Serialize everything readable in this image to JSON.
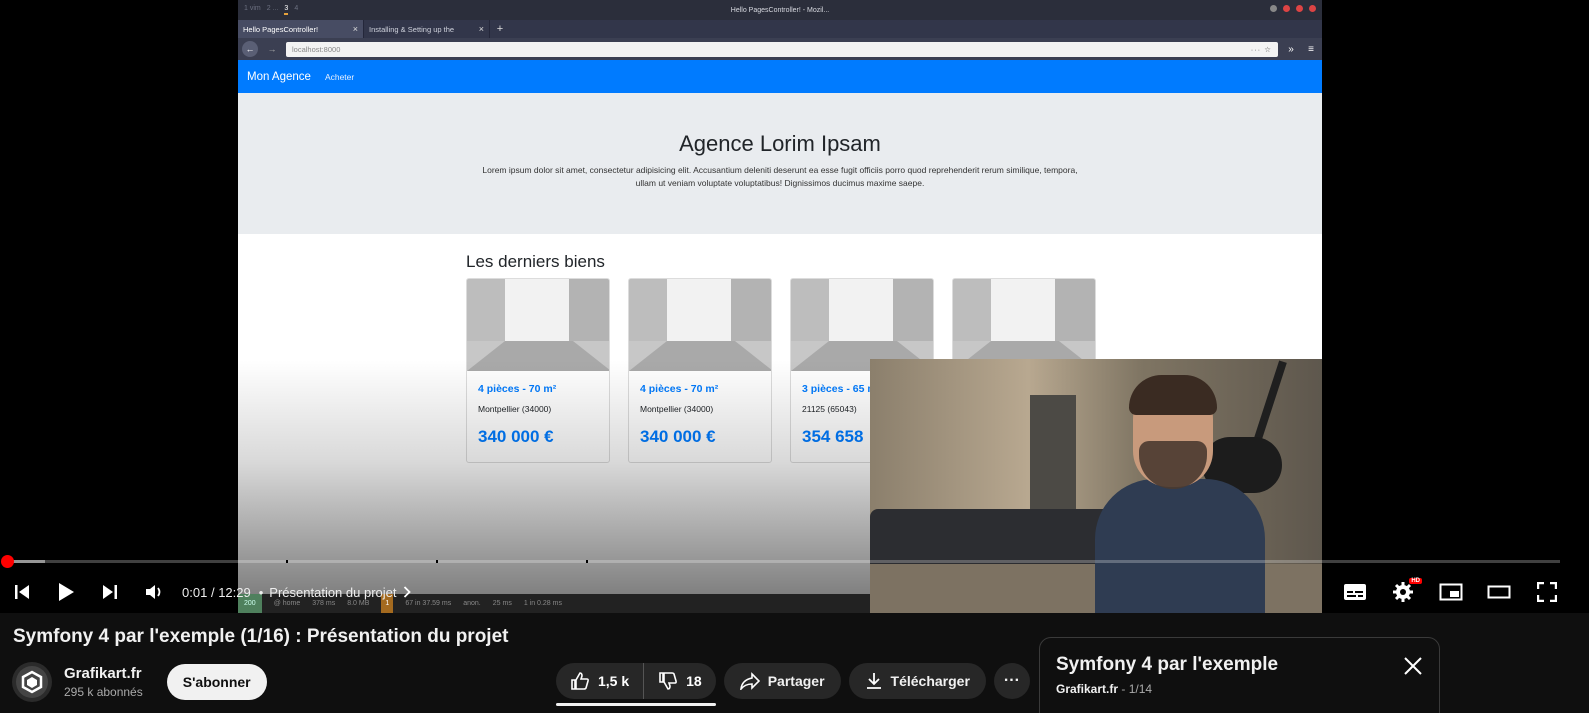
{
  "browser": {
    "workspaces": [
      "1 vim",
      "2 ...",
      "3",
      "4"
    ],
    "window_title": "Hello PagesController! - Mozil...",
    "tabs": [
      {
        "label": "Hello PagesController!",
        "active": true
      },
      {
        "label": "Installing & Setting up the",
        "active": false
      }
    ],
    "url": "localhost:8000"
  },
  "site": {
    "brand": "Mon Agence",
    "nav_link": "Acheter",
    "hero_title": "Agence Lorim Ipsam",
    "hero_text": "Lorem ipsum dolor sit amet, consectetur adipisicing elit. Accusantium deleniti deserunt ea esse fugit officiis porro quod reprehenderit rerum similique, tempora, ullam ut veniam voluptate voluptatibus! Dignissimos ducimus maxime saepe.",
    "section_title": "Les derniers biens",
    "cards": [
      {
        "title": "4 pièces - 70 m²",
        "location": "Montpellier (34000)",
        "price": "340 000 €"
      },
      {
        "title": "4 pièces - 70 m²",
        "location": "Montpellier (34000)",
        "price": "340 000 €"
      },
      {
        "title": "3 pièces - 65 m",
        "location": "21125 (65043)",
        "price": "354 658"
      },
      {
        "title": "",
        "location": "",
        "price": ""
      }
    ]
  },
  "debug_bar": {
    "status": "200",
    "route": "@ home",
    "time": "378 ms",
    "memory": "8.0 MB",
    "warnings": "1",
    "cache": "67 in 37.59 ms",
    "user": "anon.",
    "twig": "25 ms",
    "db": "1 in 0.28 ms"
  },
  "player": {
    "time_current": "0:01",
    "time_total": "12:29",
    "time_separator": "/",
    "chapter": "Présentation du projet",
    "progress_fraction": 0.0008,
    "buffer_fraction": 0.025,
    "hd_badge": "HD"
  },
  "video": {
    "title": "Symfony 4 par l'exemple (1/16) : Présentation du projet",
    "channel_name": "Grafikart.fr",
    "subscribers": "295 k abonnés",
    "subscribe_label": "S'abonner",
    "likes": "1,5 k",
    "dislikes": "18",
    "share_label": "Partager",
    "download_label": "Télécharger"
  },
  "playlist": {
    "title": "Symfony 4 par l'exemple",
    "owner": "Grafikart.fr",
    "separator": " - ",
    "position": "1/14"
  },
  "colors": {
    "accent": "#ff0000",
    "site_primary": "#007bff"
  }
}
